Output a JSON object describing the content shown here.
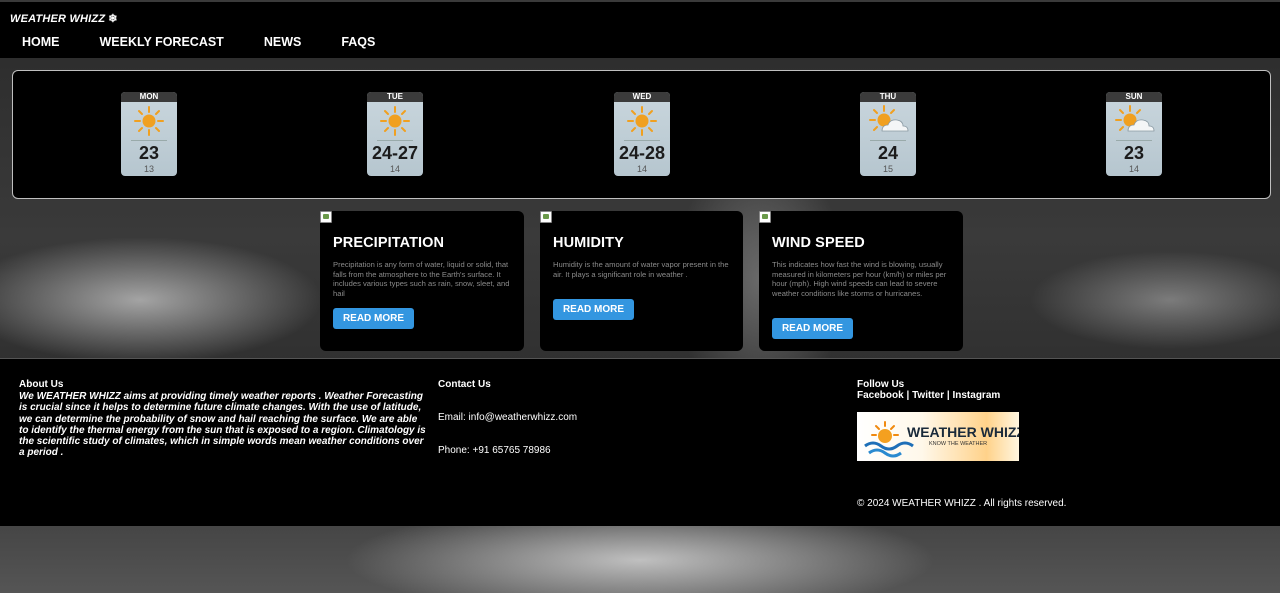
{
  "brand": {
    "name": "WEATHER WHIZZ",
    "icon": "snowflake-icon",
    "glyph": "❄"
  },
  "nav": {
    "items": [
      "HOME",
      "WEEKLY FORECAST",
      "NEWS",
      "FAQS"
    ]
  },
  "forecast": {
    "days": [
      {
        "day": "MON",
        "temp": "23",
        "low": "13",
        "icon": "sunny-icon"
      },
      {
        "day": "TUE",
        "temp": "24-27",
        "low": "14",
        "icon": "sunny-icon"
      },
      {
        "day": "WED",
        "temp": "24-28",
        "low": "14",
        "icon": "sunny-icon"
      },
      {
        "day": "THU",
        "temp": "24",
        "low": "15",
        "icon": "partly-cloudy-icon"
      },
      {
        "day": "SUN",
        "temp": "23",
        "low": "14",
        "icon": "partly-cloudy-icon"
      }
    ]
  },
  "cards": [
    {
      "title": "PRECIPITATION",
      "text": "Precipitation is any form of water, liquid or solid, that falls from the atmosphere to the Earth's surface. It includes various types such as rain, snow, sleet, and hail",
      "button": "READ MORE"
    },
    {
      "title": "HUMIDITY",
      "text": "Humidity is the amount of water vapor present in the air. It plays a significant role in weather .",
      "button": "READ MORE"
    },
    {
      "title": "WIND SPEED",
      "text": "This indicates how fast the wind is blowing, usually measured in kilometers per hour (km/h) or miles per hour (mph). High wind speeds can lead to severe weather conditions like storms or hurricanes.",
      "button": "READ MORE"
    }
  ],
  "footer": {
    "about_title": "About Us",
    "about_text": "We WEATHER WHIZZ aims at providing timely weather reports . Weather Forecasting is crucial since it helps to determine future climate changes. With the use of latitude, we can determine the probability of snow and hail reaching the surface. We are able to identify the thermal energy from the sun that is exposed to a region. Climatology is the scientific study of climates, which in simple words mean weather conditions over a period .",
    "contact_title": "Contact Us",
    "email": "Email: info@weatherwhizz.com",
    "phone": "Phone: +91 65765 78986",
    "follow_title": "Follow Us",
    "social": [
      "Facebook",
      "Twitter",
      "Instagram"
    ],
    "separator": "|",
    "logo_name": "WEATHER WHIZZ",
    "logo_tagline": "KNOW THE WEATHER",
    "copyright": "© 2024 WEATHER WHIZZ . All rights reserved."
  },
  "colors": {
    "accent": "#3396e0",
    "panel": "#000000",
    "tile": "#c3d1d9",
    "sun": "#f0a020"
  }
}
